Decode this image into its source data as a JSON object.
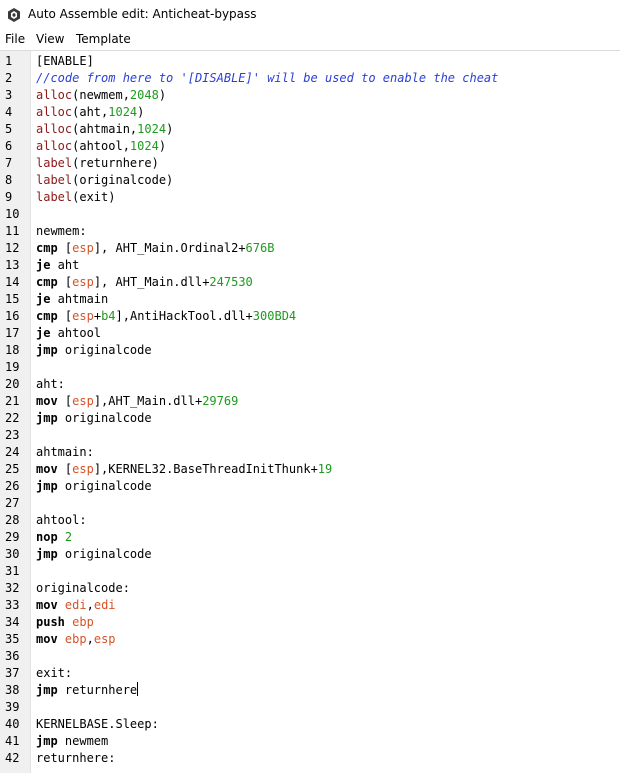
{
  "window": {
    "title": "Auto Assemble edit: Anticheat-bypass",
    "icon": "cheat-engine-icon"
  },
  "menu": [
    {
      "label": "File"
    },
    {
      "label": "View"
    },
    {
      "label": "Template"
    }
  ],
  "colors": {
    "keyword": "#000000",
    "directive": "#8b1a1a",
    "number": "#1e9a1e",
    "register": "#d4542a",
    "comment": "#2a3fd4",
    "gutter": "#f0f0f0"
  },
  "editor": {
    "caret_line": 38,
    "lines": [
      {
        "n": "1",
        "tokens": [
          [
            "[ENABLE]",
            "plain"
          ]
        ]
      },
      {
        "n": "2",
        "tokens": [
          [
            "//code from here to '[DISABLE]' will be used to enable the cheat",
            "comment"
          ]
        ]
      },
      {
        "n": "3",
        "tokens": [
          [
            "alloc",
            "alloc"
          ],
          [
            "(newmem,",
            "plain"
          ],
          [
            "2048",
            "num"
          ],
          [
            ")",
            "plain"
          ]
        ]
      },
      {
        "n": "4",
        "tokens": [
          [
            "alloc",
            "alloc"
          ],
          [
            "(aht,",
            "plain"
          ],
          [
            "1024",
            "num"
          ],
          [
            ")",
            "plain"
          ]
        ]
      },
      {
        "n": "5",
        "tokens": [
          [
            "alloc",
            "alloc"
          ],
          [
            "(ahtmain,",
            "plain"
          ],
          [
            "1024",
            "num"
          ],
          [
            ")",
            "plain"
          ]
        ]
      },
      {
        "n": "6",
        "tokens": [
          [
            "alloc",
            "alloc"
          ],
          [
            "(ahtool,",
            "plain"
          ],
          [
            "1024",
            "num"
          ],
          [
            ")",
            "plain"
          ]
        ]
      },
      {
        "n": "7",
        "tokens": [
          [
            "label",
            "alloc"
          ],
          [
            "(returnhere)",
            "plain"
          ]
        ]
      },
      {
        "n": "8",
        "tokens": [
          [
            "label",
            "alloc"
          ],
          [
            "(originalcode)",
            "plain"
          ]
        ]
      },
      {
        "n": "9",
        "tokens": [
          [
            "label",
            "alloc"
          ],
          [
            "(exit)",
            "plain"
          ]
        ]
      },
      {
        "n": "10",
        "tokens": []
      },
      {
        "n": "11",
        "tokens": [
          [
            "newmem:",
            "plain"
          ]
        ]
      },
      {
        "n": "12",
        "tokens": [
          [
            "cmp",
            "kw"
          ],
          [
            " [",
            "plain"
          ],
          [
            "esp",
            "reg"
          ],
          [
            "], AHT_Main.Ordinal2+",
            "plain"
          ],
          [
            "676B",
            "num"
          ]
        ]
      },
      {
        "n": "13",
        "tokens": [
          [
            "je",
            "kw"
          ],
          [
            " aht",
            "plain"
          ]
        ]
      },
      {
        "n": "14",
        "tokens": [
          [
            "cmp",
            "kw"
          ],
          [
            " [",
            "plain"
          ],
          [
            "esp",
            "reg"
          ],
          [
            "], AHT_Main.dll+",
            "plain"
          ],
          [
            "247530",
            "num"
          ]
        ]
      },
      {
        "n": "15",
        "tokens": [
          [
            "je",
            "kw"
          ],
          [
            " ahtmain",
            "plain"
          ]
        ]
      },
      {
        "n": "16",
        "tokens": [
          [
            "cmp",
            "kw"
          ],
          [
            " [",
            "plain"
          ],
          [
            "esp",
            "reg"
          ],
          [
            "+",
            "plain"
          ],
          [
            "b4",
            "num"
          ],
          [
            "],AntiHackTool.dll+",
            "plain"
          ],
          [
            "300BD4",
            "num"
          ]
        ]
      },
      {
        "n": "17",
        "tokens": [
          [
            "je",
            "kw"
          ],
          [
            " ahtool",
            "plain"
          ]
        ]
      },
      {
        "n": "18",
        "tokens": [
          [
            "jmp",
            "kw"
          ],
          [
            " originalcode",
            "plain"
          ]
        ]
      },
      {
        "n": "19",
        "tokens": []
      },
      {
        "n": "20",
        "tokens": [
          [
            "aht:",
            "plain"
          ]
        ]
      },
      {
        "n": "21",
        "tokens": [
          [
            "mov",
            "kw"
          ],
          [
            " [",
            "plain"
          ],
          [
            "esp",
            "reg"
          ],
          [
            "],AHT_Main.dll+",
            "plain"
          ],
          [
            "29769",
            "num"
          ]
        ]
      },
      {
        "n": "22",
        "tokens": [
          [
            "jmp",
            "kw"
          ],
          [
            " originalcode",
            "plain"
          ]
        ]
      },
      {
        "n": "23",
        "tokens": []
      },
      {
        "n": "24",
        "tokens": [
          [
            "ahtmain:",
            "plain"
          ]
        ]
      },
      {
        "n": "25",
        "tokens": [
          [
            "mov",
            "kw"
          ],
          [
            " [",
            "plain"
          ],
          [
            "esp",
            "reg"
          ],
          [
            "],KERNEL32.BaseThreadInitThunk+",
            "plain"
          ],
          [
            "19",
            "num"
          ]
        ]
      },
      {
        "n": "26",
        "tokens": [
          [
            "jmp",
            "kw"
          ],
          [
            " originalcode",
            "plain"
          ]
        ]
      },
      {
        "n": "27",
        "tokens": []
      },
      {
        "n": "28",
        "tokens": [
          [
            "ahtool:",
            "plain"
          ]
        ]
      },
      {
        "n": "29",
        "tokens": [
          [
            "nop",
            "kw"
          ],
          [
            " ",
            "plain"
          ],
          [
            "2",
            "num"
          ]
        ]
      },
      {
        "n": "30",
        "tokens": [
          [
            "jmp",
            "kw"
          ],
          [
            " originalcode",
            "plain"
          ]
        ]
      },
      {
        "n": "31",
        "tokens": []
      },
      {
        "n": "32",
        "tokens": [
          [
            "originalcode:",
            "plain"
          ]
        ]
      },
      {
        "n": "33",
        "tokens": [
          [
            "mov",
            "kw"
          ],
          [
            " ",
            "plain"
          ],
          [
            "edi",
            "reg"
          ],
          [
            ",",
            "plain"
          ],
          [
            "edi",
            "reg"
          ]
        ]
      },
      {
        "n": "34",
        "tokens": [
          [
            "push",
            "kw"
          ],
          [
            " ",
            "plain"
          ],
          [
            "ebp",
            "reg"
          ]
        ]
      },
      {
        "n": "35",
        "tokens": [
          [
            "mov",
            "kw"
          ],
          [
            " ",
            "plain"
          ],
          [
            "ebp",
            "reg"
          ],
          [
            ",",
            "plain"
          ],
          [
            "esp",
            "reg"
          ]
        ]
      },
      {
        "n": "36",
        "tokens": []
      },
      {
        "n": "37",
        "tokens": [
          [
            "exit:",
            "plain"
          ]
        ]
      },
      {
        "n": "38",
        "tokens": [
          [
            "jmp",
            "kw"
          ],
          [
            " returnhere",
            "plain"
          ]
        ]
      },
      {
        "n": "39",
        "tokens": []
      },
      {
        "n": "40",
        "tokens": [
          [
            "KERNELBASE.Sleep:",
            "plain"
          ]
        ]
      },
      {
        "n": "41",
        "tokens": [
          [
            "jmp",
            "kw"
          ],
          [
            " newmem",
            "plain"
          ]
        ]
      },
      {
        "n": "42",
        "tokens": [
          [
            "returnhere:",
            "plain"
          ]
        ]
      }
    ]
  }
}
